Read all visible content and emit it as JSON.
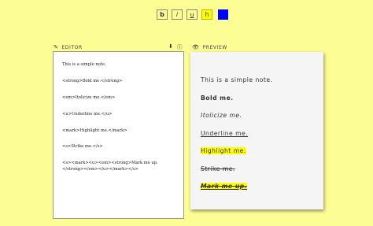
{
  "toolbar": {
    "bold_label": "b",
    "italic_label": "i",
    "underline_label": "u",
    "highlight_label": "h",
    "color_swatch": "#0000ff"
  },
  "editor": {
    "label": "EDITOR",
    "lines": [
      "This is a simple note.",
      "<strong>Bold me.</strong>",
      "<em>Itolicize me.</em>",
      "<u>Underline me.</u>",
      "<mark>Highlight me.</mark>",
      "<s>Strike me.</s>",
      "<s><mark><u><em><strong>Mark me up.</strong></em></u></mark></s>"
    ]
  },
  "preview": {
    "label": "PREVIEW",
    "lines": [
      "This is a simple note.",
      "Bold me.",
      "Itolicize me.",
      "Underline me.",
      "Highlight me.",
      "Strike me.",
      "Mark me up."
    ]
  },
  "colors": {
    "background": "#fdfd96",
    "highlight": "#ffff00"
  }
}
